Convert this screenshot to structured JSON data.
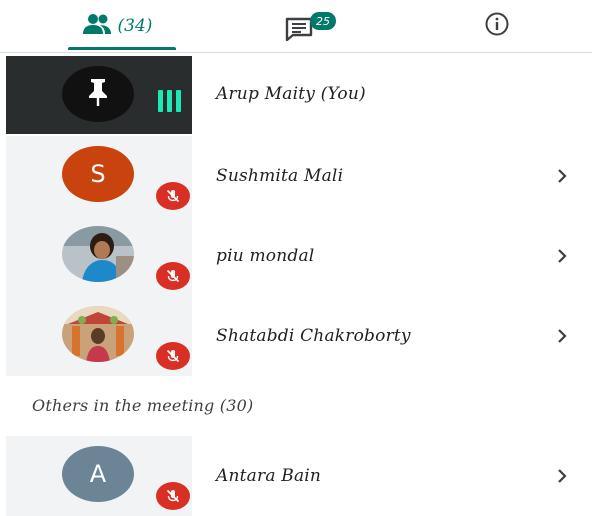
{
  "tabs": {
    "people_count": "(34)",
    "chat_badge": "25"
  },
  "participants": [
    {
      "name": "Arup Maity (You)",
      "avatar_type": "pin-icon",
      "status": "speaking-levels"
    },
    {
      "name": "Sushmita Mali",
      "avatar_letter": "S",
      "avatar_color": "#c9430f",
      "status": "muted"
    },
    {
      "name": "piu mondal",
      "avatar_type": "photo",
      "status": "muted"
    },
    {
      "name": "Shatabdi Chakroborty",
      "avatar_type": "photo",
      "status": "muted"
    }
  ],
  "others": {
    "label": "Others in the meeting (30)",
    "participants": [
      {
        "name": "Antara Bain",
        "avatar_letter": "A",
        "avatar_color": "#6b8596",
        "status": "muted"
      }
    ]
  },
  "colors": {
    "accent": "#00796b",
    "muted_red": "#d93025",
    "self_row": "#2a2d2e",
    "level_green": "#1de9b6"
  }
}
